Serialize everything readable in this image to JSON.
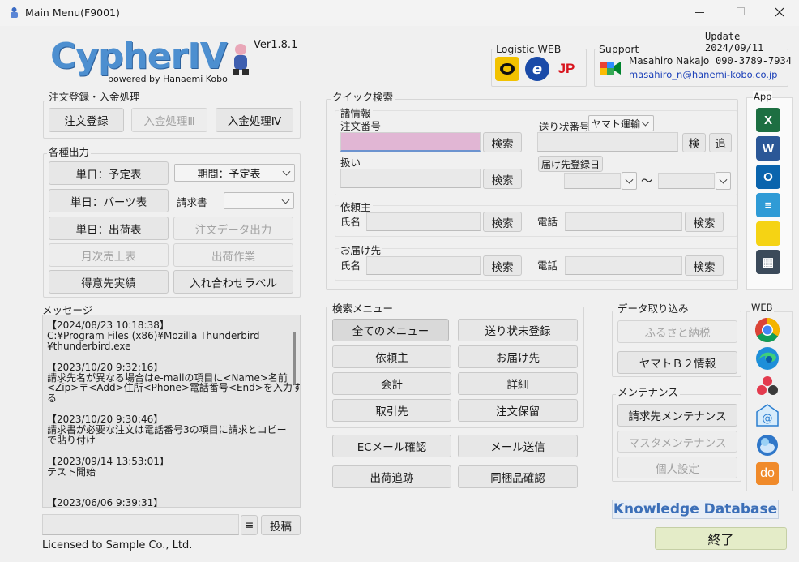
{
  "window": {
    "title": "Main Menu(F9001)",
    "update": "Update 2024/09/11"
  },
  "logo": {
    "name": "CypherIV",
    "powered": "powered by Hanaemi Kobo",
    "version": "Ver1.8.1"
  },
  "logistics": {
    "title": "Logistic WEB",
    "carriers": [
      {
        "label": "ヤマト運輸",
        "color": "#f2c200"
      },
      {
        "label": "佐川急便",
        "color": "#1a4aa8"
      },
      {
        "label": "日本郵便",
        "color": "#d8141d"
      }
    ]
  },
  "support": {
    "title": "Support",
    "name": "Masahiro Nakajo",
    "phone": "090-3789-7934",
    "email": "masahiro_n@hanemi-kobo.co.jp"
  },
  "order_group": {
    "title": "注文登録・入金処理",
    "register": "注文登録",
    "payment3": "入金処理Ⅲ",
    "payment4": "入金処理Ⅳ"
  },
  "output_group": {
    "title": "各種出力",
    "daily_schedule": "単日：予定表",
    "period_schedule": "期間：予定表",
    "daily_parts": "単日：パーツ表",
    "invoice_label": "請求書",
    "invoice_value": "",
    "daily_ship": "単日：出荷表",
    "order_data_out": "注文データ出力",
    "monthly_sales": "月次売上表",
    "ship_work": "出荷作業",
    "client_results": "得意先実績",
    "packing_label": "入れ合わせラベル"
  },
  "messages": {
    "title": "メッセージ",
    "lines": [
      "【2024/08/23 10:18:38】",
      "C:¥Program Files (x86)¥Mozilla Thunderbird",
      "¥thunderbird.exe",
      "",
      "【2023/10/20 9:32:16】",
      "請求先名が異なる場合はe-mailの項目に<Name>名前",
      "<Zip>〒<Add>住所<Phone>電話番号<End>を入力す",
      "る",
      "",
      "【2023/10/20 9:30:46】",
      "請求書が必要な注文は電話番号3の項目に請求とコピー",
      "で貼り付け",
      "",
      "【2023/09/14 13:53:01】",
      "テスト開始",
      "",
      "",
      "【2023/06/06 9:39:31】"
    ],
    "menu_icon": "≡",
    "post": "投稿"
  },
  "license": "Licensed to Sample Co., Ltd.",
  "quick_search": {
    "title": "クイック検索",
    "info_title": "諸情報",
    "order_no_label": "注文番号",
    "order_search": "検索",
    "tracking_label": "送り状番号",
    "carrier_value": "ヤマト運輸",
    "inspect": "検",
    "add": "追",
    "handling_label": "扱い",
    "handling_search": "検索",
    "delivery_date": "届け先登録日",
    "range_sep": "～",
    "client_title": "依頼主",
    "client_name_label": "氏名",
    "client_name_search": "検索",
    "client_phone_label": "電話",
    "client_phone_search": "検索",
    "dest_title": "お届け先",
    "dest_name_label": "氏名",
    "dest_name_search": "検索",
    "dest_phone_label": "電話",
    "dest_phone_search": "検索"
  },
  "search_menu": {
    "title": "検索メニュー",
    "all": "全てのメニュー",
    "untracked": "送り状未登録",
    "client": "依頼主",
    "destination": "お届け先",
    "accounting": "会計",
    "detail": "詳細",
    "partner": "取引先",
    "on_hold": "注文保留",
    "ec_mail": "ECメール確認",
    "send_mail": "メール送信",
    "ship_track": "出荷追跡",
    "bundle_check": "同梱品確認"
  },
  "import": {
    "title": "データ取り込み",
    "furusato": "ふるさと納税",
    "yamato_b2": "ヤマトＢ２情報"
  },
  "maintenance": {
    "title": "メンテナンス",
    "billing": "請求先メンテナンス",
    "master": "マスタメンテナンス",
    "personal": "個人設定"
  },
  "app_panel": {
    "title": "App",
    "apps": [
      {
        "name": "excel",
        "letter": "X",
        "color": "#1d6f42"
      },
      {
        "name": "word",
        "letter": "W",
        "color": "#2b5797"
      },
      {
        "name": "outlook",
        "letter": "O",
        "color": "#0a64ad"
      },
      {
        "name": "notepad",
        "letter": "≡",
        "color": "#2f9bd6"
      },
      {
        "name": "sticky-notes",
        "letter": "",
        "color": "#f5d314"
      },
      {
        "name": "calculator",
        "letter": "▦",
        "color": "#3b4a5a"
      }
    ]
  },
  "web_panel": {
    "title": "WEB"
  },
  "knowledge": "Knowledge Database",
  "exit": "終了"
}
